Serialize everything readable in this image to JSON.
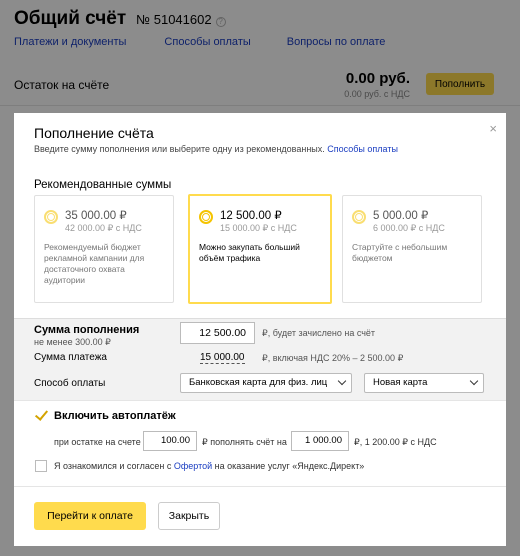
{
  "account": {
    "title": "Общий счёт",
    "number": "№ 51041602",
    "help": "?",
    "links": [
      "Платежи и документы",
      "Способы оплаты",
      "Вопросы по оплате"
    ],
    "balance_label": "Остаток на счёте",
    "balance_amount": "0.00 руб.",
    "balance_vat": "0.00 руб. с НДС",
    "topup_label": "Пополнить"
  },
  "modal": {
    "title": "Пополнение счёта",
    "subtitle": "Введите сумму пополнения или выберите одну из рекомендованных.",
    "subtitle_link": "Способы оплаты",
    "close": "×",
    "recommended_title": "Рекомендованные суммы",
    "cards": [
      {
        "amount": "35 000.00 ₽",
        "vat": "42 000.00 ₽ с НДС",
        "desc": "Рекомендуемый бюджет рекламной кампании для достаточного охвата аудитории",
        "selected": false
      },
      {
        "amount": "12 500.00 ₽",
        "vat": "15 000.00 ₽ с НДС",
        "desc": "Можно закупать больший объём трафика",
        "selected": true
      },
      {
        "amount": "5 000.00 ₽",
        "vat": "6 000.00 ₽ с НДС",
        "desc": "Стартуйте с небольшим бюджетом",
        "selected": false
      }
    ],
    "topup_sum_label": "Сумма пополнения",
    "topup_min": "не менее 300.00 ₽",
    "topup_value": "12 500.00",
    "topup_note": "₽, будет зачислено на счёт",
    "payment_sum_label": "Сумма платежа",
    "payment_sum_value": "15 000.00",
    "payment_sum_note": "₽, включая НДС 20% – 2 500.00 ₽",
    "method_label": "Способ оплаты",
    "method_value": "Банковская карта для физ. лиц",
    "card_value": "Новая карта",
    "autopay_label": "Включить автоплатёж",
    "autopay_checked": true,
    "autopay_text1": "при остатке на счете",
    "autopay_threshold": "100.00",
    "autopay_text2": "₽ пополнять счёт на",
    "autopay_amount": "1 000.00",
    "autopay_text3": "₽, 1 200.00 ₽ с НДС",
    "agree_text1": "Я ознакомился и согласен с",
    "agree_link": "Офертой",
    "agree_text2": "на оказание услуг «Яндекс.Директ»",
    "pay_button": "Перейти к оплате",
    "close_button": "Закрыть"
  },
  "colors": {
    "accent": "#ffdb4d",
    "link": "#1a3dc1",
    "coin": "#f5c400"
  }
}
